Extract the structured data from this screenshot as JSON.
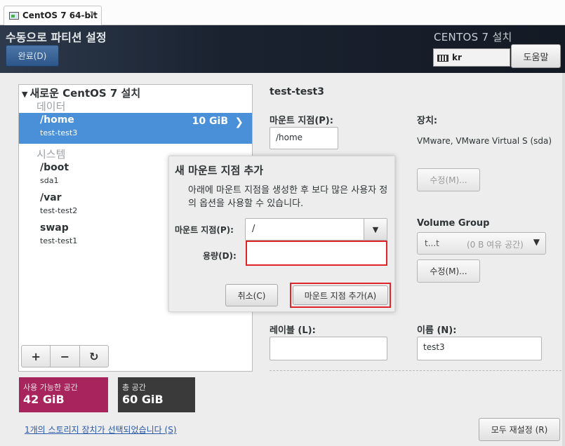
{
  "vm_tab": {
    "label": "CentOS 7 64-bit",
    "close": "✕"
  },
  "header": {
    "page_title": "수동으로 파티션 설정",
    "done_label": "완료(D)",
    "product_title": "CENTOS 7 설치",
    "keyboard_layout": "kr",
    "help_label": "도움말"
  },
  "tree": {
    "root_label": "새로운 CentOS 7 설치",
    "sections": [
      {
        "label": "데이터"
      },
      {
        "label": "시스템"
      }
    ],
    "mountpoints": [
      {
        "name": "/home",
        "device": "test-test3",
        "size": "10 GiB",
        "selected": true
      },
      {
        "name": "/boot",
        "device": "sda1"
      },
      {
        "name": "/var",
        "device": "test-test2"
      },
      {
        "name": "swap",
        "device": "test-test1"
      }
    ]
  },
  "toolbar": {
    "add": "+",
    "remove": "−",
    "refresh": "↻"
  },
  "space": {
    "available_label": "사용 가능한 공간",
    "available_value": "42 GiB",
    "total_label": "총 공간",
    "total_value": "60 GiB"
  },
  "storage_link": "1개의 스토리지 장치가 선택되었습니다 (S)",
  "details": {
    "title": "test-test3",
    "mountpoint_label": "마운트 지점(P):",
    "mountpoint_value": "/home",
    "device_label": "장치:",
    "device_value": "VMware, VMware Virtual S (sda)",
    "modify_label": "수정(M)...",
    "vg_label": "Volume Group",
    "vg_name": "t...t",
    "vg_free": "(0 B 여유 공간)",
    "vg_modify_label": "수정(M)...",
    "label_label": "레이블 (L):",
    "label_value": "",
    "name_label": "이름 (N):",
    "name_value": "test3"
  },
  "reset_label": "모두 재설정 (R)",
  "dialog": {
    "title": "새 마운트 지점 추가",
    "description": "아래에 마운트 지점을 생성한 후 보다 많은 사용자 정의 옵션을 사용할 수 있습니다.",
    "mountpoint_label": "마운트 지점(P):",
    "mountpoint_value": "/",
    "capacity_label": "용량(D):",
    "capacity_value": "",
    "cancel_label": "취소(C)",
    "add_label": "마운트 지점 추가(A)"
  }
}
